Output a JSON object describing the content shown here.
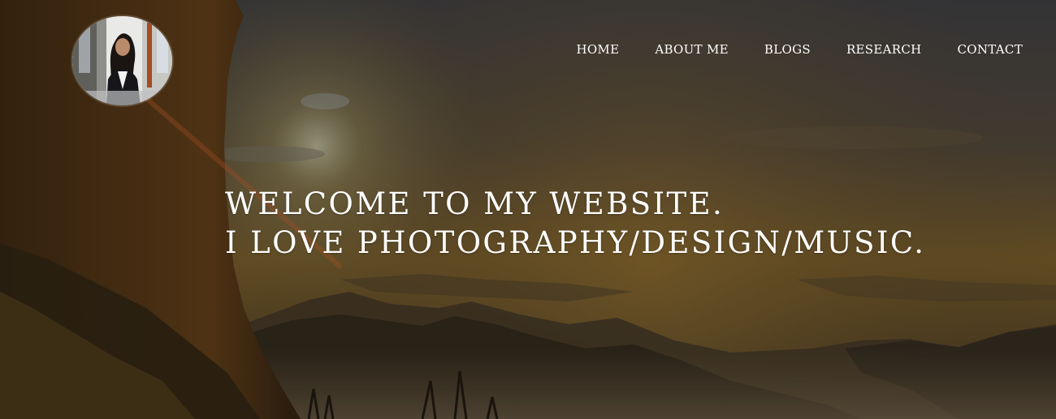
{
  "nav": {
    "items": [
      {
        "label": "HOME"
      },
      {
        "label": "ABOUT ME"
      },
      {
        "label": "BLOGS"
      },
      {
        "label": "RESEARCH"
      },
      {
        "label": "CONTACT"
      }
    ]
  },
  "hero": {
    "line1": "WELCOME TO MY WEBSITE.",
    "line2": "I LOVE PHOTOGRAPHY/DESIGN/MUSIC."
  },
  "colors": {
    "text": "#ffffff",
    "sky_top": "#3a3a3d",
    "sky_glow": "#8a6a2c",
    "cliff": "#3b2a14"
  },
  "icons": {
    "avatar": "profile-photo"
  }
}
